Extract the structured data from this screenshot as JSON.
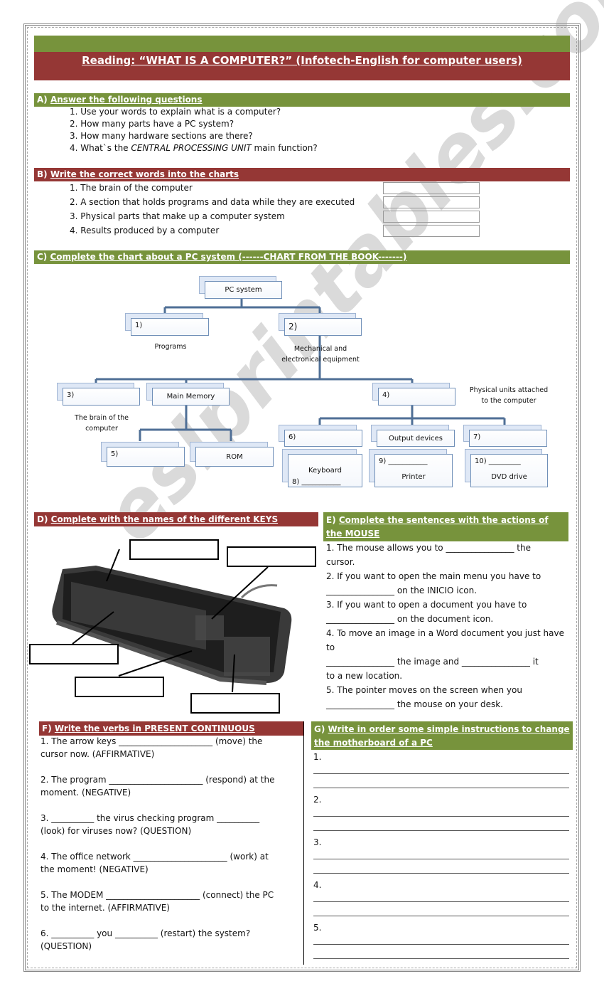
{
  "title": "Reading: “WHAT IS A COMPUTER?” (Infotech-English for computer users)",
  "colors": {
    "green": "#77933c",
    "red": "#953735",
    "chart_border": "#6f8fb8"
  },
  "watermark": "eslprintables.com",
  "sectionA": {
    "heading_prefix": "A)",
    "heading": "Answer the following questions",
    "questions": [
      "1. Use your words to explain what is a computer?",
      "2. How many parts have a PC system?",
      "3. How many hardware sections are there?"
    ],
    "q4_pre": "4. What`s the ",
    "q4_em": "CENTRAL PROCESSING UNIT",
    "q4_post": " main function?"
  },
  "sectionB": {
    "heading_prefix": "B)",
    "heading": "Write the correct words into the charts",
    "items": [
      "1. The brain of the computer",
      "2. A section that holds programs and data while they are executed",
      "3. Physical parts that make up a computer system",
      "4. Results produced by a computer"
    ]
  },
  "sectionC": {
    "heading_prefix": "C)",
    "heading": "Complete the chart about a PC system (------CHART FROM THE BOOK-------)",
    "chart": {
      "root": "PC system",
      "n1": "1)",
      "n2": "2)",
      "programs": "Programs",
      "mech1": "Mechanical and",
      "mech2": "electronical equipment",
      "n3": "3)",
      "main_memory": "Main Memory",
      "n4": "4)",
      "phys1": "Physical units attached",
      "phys2": "to the computer",
      "brain1": "The brain of the",
      "brain2": "computer",
      "n5": "5)",
      "rom": "ROM",
      "n6": "6)",
      "output": "Output devices",
      "n7": "7)",
      "keyboard": "Keyboard",
      "n8": "8) ___________",
      "n9": "9) ___________",
      "printer": "Printer",
      "n10": "10) _________",
      "dvd": "DVD drive"
    }
  },
  "sectionD": {
    "heading_prefix": "D)",
    "heading": "Complete with the names of the different KEYS"
  },
  "sectionE": {
    "heading_prefix": "E)",
    "heading": "Complete the sentences with the actions of the MOUSE",
    "lines": [
      "1. The mouse allows you to ________________ the",
      "cursor.",
      "2. If you want to open the main menu you have to",
      "________________ on the INICIO icon.",
      "3. If you want to open a document you have to",
      "________________ on the document icon.",
      "4. To move an image in a Word document you just have to",
      "________________ the image and ________________ it",
      "to a new location.",
      "5.  The pointer moves on the screen when you",
      "________________ the mouse on your desk."
    ]
  },
  "sectionF": {
    "heading_prefix": "F)",
    "heading": "Write the verbs in PRESENT CONTINUOUS",
    "items": [
      [
        "1. The arrow keys ______________________ (move) the",
        "cursor now. (AFFIRMATIVE)"
      ],
      [
        "2. The program ______________________ (respond) at the",
        "moment. (NEGATIVE)"
      ],
      [
        "3. __________ the virus checking program __________",
        "(look) for viruses now? (QUESTION)"
      ],
      [
        "4. The office network ______________________ (work) at",
        "the moment! (NEGATIVE)"
      ],
      [
        "5. The MODEM ______________________  (connect) the PC",
        "to the internet. (AFFIRMATIVE)"
      ],
      [
        "6. __________ you __________ (restart) the system?",
        "(QUESTION)"
      ]
    ]
  },
  "sectionG": {
    "heading_prefix": "G)",
    "heading": "Write in order some simple instructions to change the motherboard of a PC",
    "numbers": [
      "1.",
      "2.",
      "3.",
      "4.",
      "5."
    ]
  }
}
